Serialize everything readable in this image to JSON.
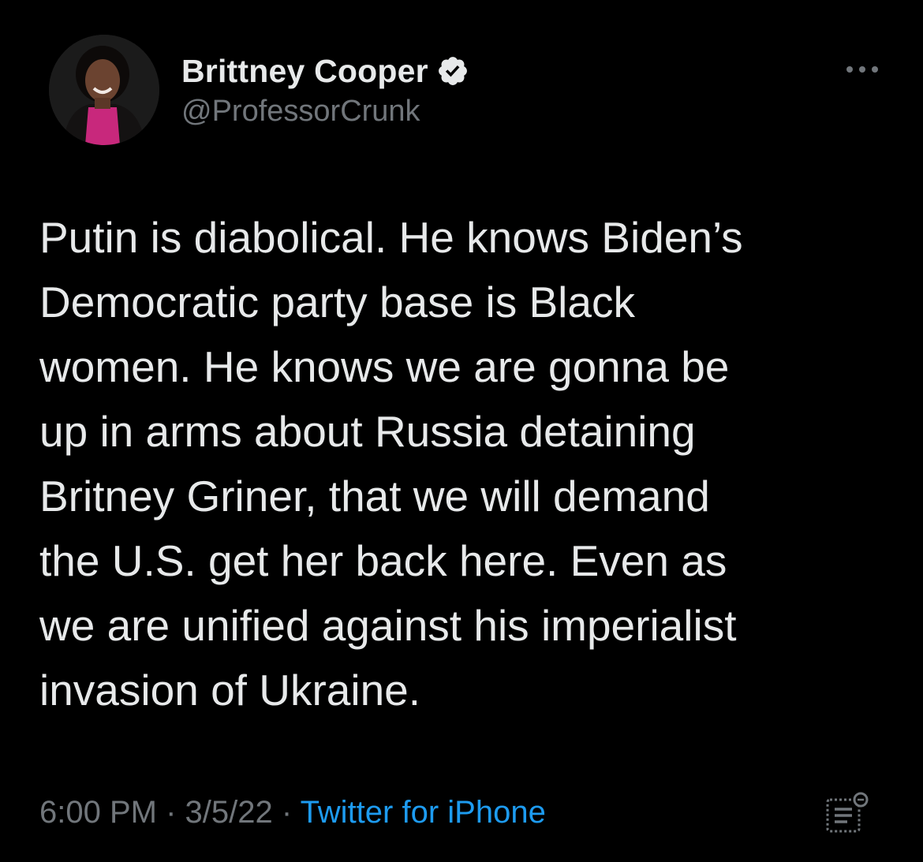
{
  "author": {
    "name": "Brittney Cooper",
    "handle": "@ProfessorCrunk",
    "verified": true,
    "avatar_icon": "profile-photo"
  },
  "header": {
    "more_icon": "more-options-icon"
  },
  "tweet": {
    "text": "Putin is diabolical. He knows Biden’s\nDemocratic party base is Black\nwomen. He knows we are gonna be\nup in arms about Russia detaining\nBritney Griner, that we will demand\nthe U.S. get her back here. Even as\nwe are unified against his imperialist\ninvasion of Ukraine."
  },
  "meta": {
    "time": "6:00 PM",
    "separator": " · ",
    "date": "3/5/22",
    "source": "Twitter for iPhone"
  },
  "colors": {
    "background": "#000000",
    "text": "#e7e9ea",
    "secondary": "#71767b",
    "link": "#1d9bf0"
  }
}
